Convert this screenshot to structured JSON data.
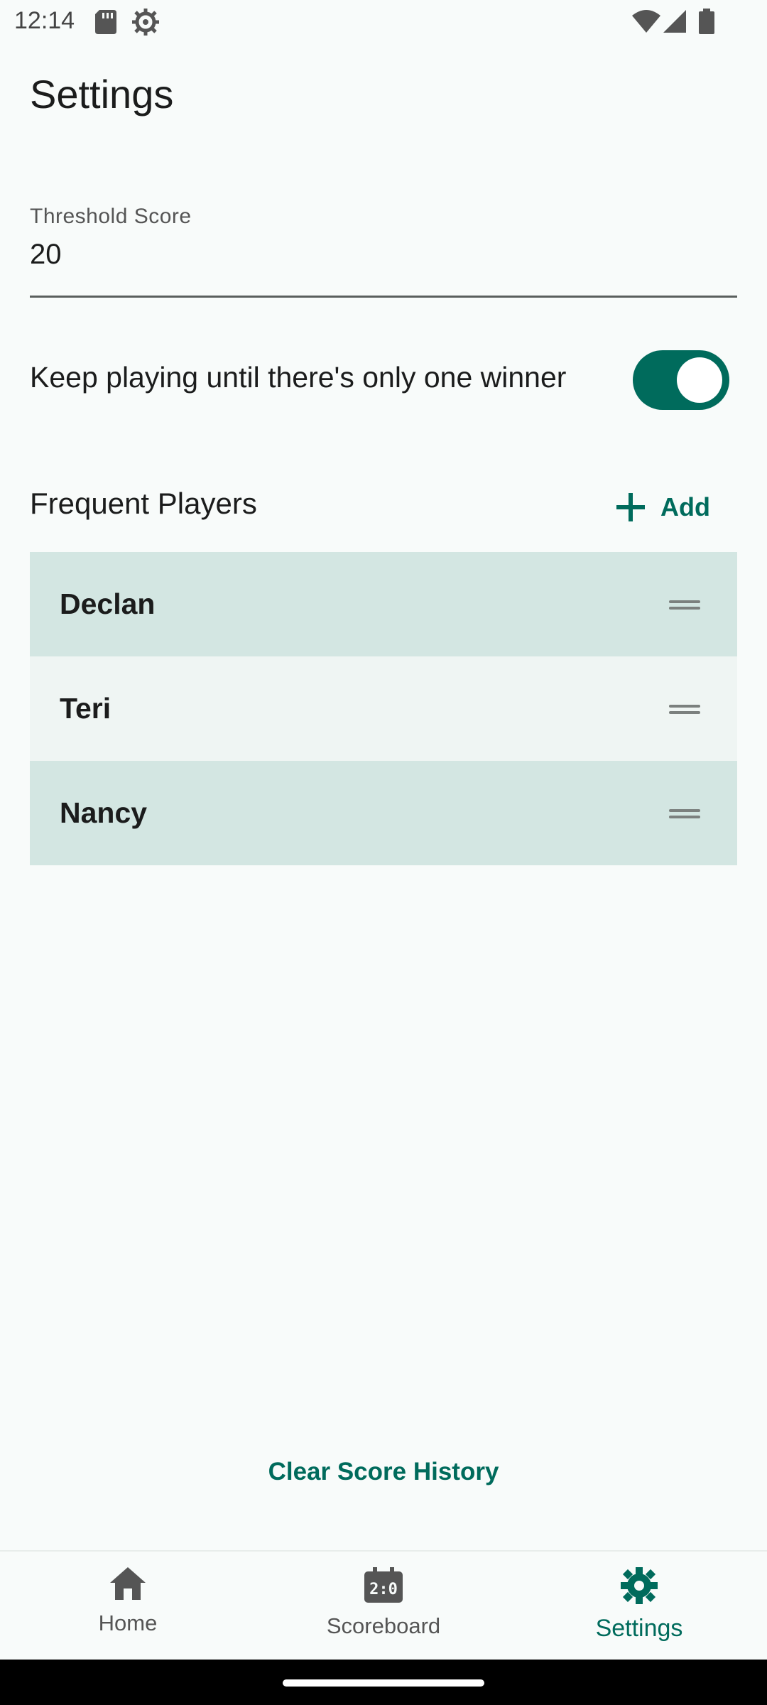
{
  "status_bar": {
    "time": "12:14",
    "icons": [
      "sd-card-icon",
      "settings-gear-icon",
      "wifi-icon",
      "signal-icon",
      "battery-icon"
    ]
  },
  "header": {
    "title": "Settings"
  },
  "threshold": {
    "label": "Threshold Score",
    "value": "20"
  },
  "keep_playing": {
    "label": "Keep playing until there's only one winner",
    "enabled": true
  },
  "players": {
    "heading": "Frequent Players",
    "add_label": "Add",
    "items": [
      {
        "name": "Declan"
      },
      {
        "name": "Teri"
      },
      {
        "name": "Nancy"
      }
    ]
  },
  "actions": {
    "clear_history": "Clear Score History"
  },
  "nav": {
    "items": [
      {
        "label": "Home",
        "icon": "home-icon"
      },
      {
        "label": "Scoreboard",
        "icon": "scoreboard-icon"
      },
      {
        "label": "Settings",
        "icon": "settings-icon",
        "active": true
      }
    ]
  },
  "colors": {
    "accent": "#006b5c",
    "row_highlight": "#d3e6e2",
    "row_plain": "#eff5f3",
    "background": "#f8fbfa"
  }
}
